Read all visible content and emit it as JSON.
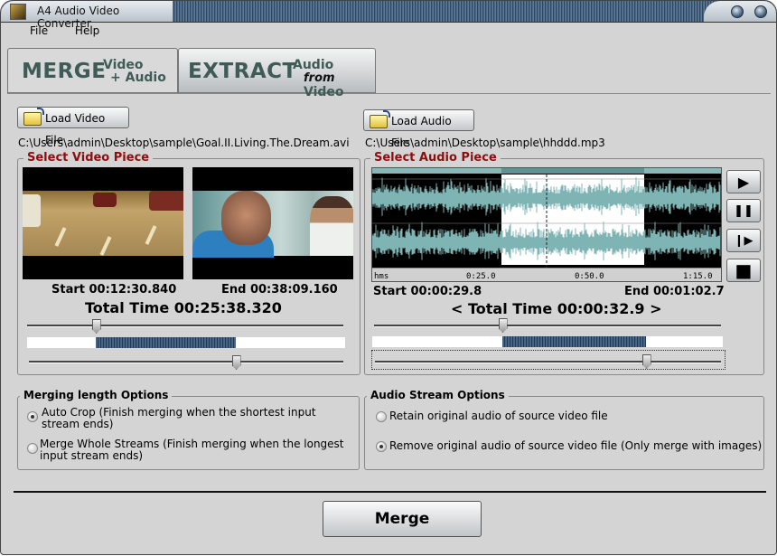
{
  "window": {
    "title": "A4 Audio Video Converter"
  },
  "menu": [
    {
      "label": "File",
      "accel": "F"
    },
    {
      "label": "Help",
      "accel": "H"
    }
  ],
  "tabs": {
    "merge": {
      "big": "MERGE",
      "line1": "Video",
      "line2": "+ Audio",
      "active": true
    },
    "extract": {
      "big": "EXTRACT",
      "line1": "Audio",
      "line2_italic": "from",
      "line2": "Video",
      "active": false
    }
  },
  "video": {
    "load_button": "Load Video File",
    "path": "C:\\Users\\admin\\Desktop\\sample\\Goal.II.Living.The.Dream.avi",
    "group_title": "Select Video Piece",
    "start": "Start 00:12:30.840",
    "end": "End 00:38:09.160",
    "total": "Total Time 00:25:38.320",
    "start_fraction": 0.215,
    "end_fraction": 0.655
  },
  "audio": {
    "load_button": "Load Audio File",
    "path": "C:\\Users\\admin\\Desktop\\sample\\hhddd.mp3",
    "group_title": "Select Audio Piece",
    "ruler": {
      "unit": "hms",
      "ticks": [
        "0:25.0",
        "0:50.0",
        "1:15.0"
      ]
    },
    "start": "Start 00:00:29.8",
    "end": "End 00:01:02.7",
    "total": "< Total Time 00:00:32.9 >",
    "start_fraction": 0.37,
    "end_fraction": 0.78,
    "controls": [
      {
        "name": "play",
        "glyph": "▶"
      },
      {
        "name": "pause",
        "glyph": "❚❚"
      },
      {
        "name": "step",
        "glyph": "❙▶"
      },
      {
        "name": "stop",
        "glyph": "■"
      }
    ]
  },
  "merging_options": {
    "title": "Merging length Options",
    "options": [
      {
        "label": "Auto Crop (Finish merging when the shortest input stream ends)",
        "selected": true
      },
      {
        "label": "Merge Whole Streams (Finish merging when the longest input stream ends)",
        "selected": false
      }
    ]
  },
  "audio_stream_options": {
    "title": "Audio Stream Options",
    "options": [
      {
        "label": "Retain original audio of source video file",
        "selected": false
      },
      {
        "label": "Remove original audio of source video file (Only merge with images)",
        "selected": true
      }
    ]
  },
  "merge_button": "Merge"
}
